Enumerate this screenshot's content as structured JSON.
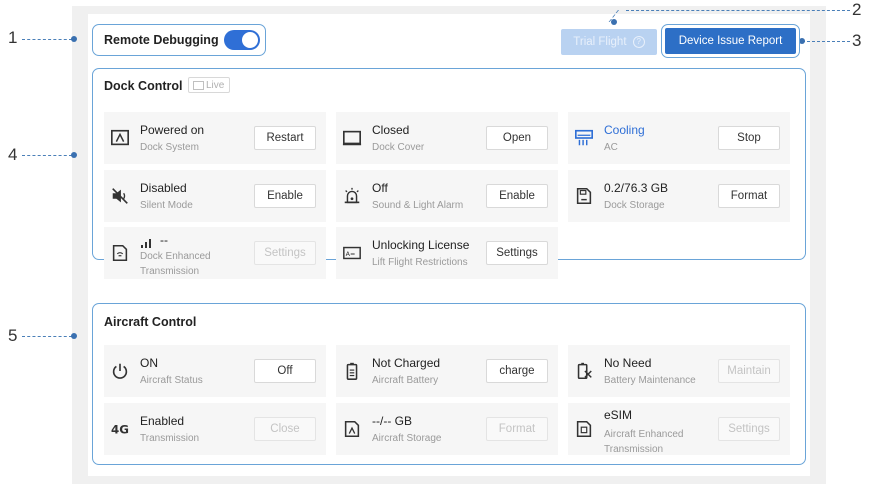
{
  "callouts": {
    "n1": "1",
    "n2": "2",
    "n3": "3",
    "n4": "4",
    "n5": "5"
  },
  "top_bar": {
    "remote_debugging_label": "Remote Debugging",
    "remote_debugging_on": true,
    "trial_flight_label": "Trial Flight",
    "device_issue_report_label": "Device Issue Report"
  },
  "dock": {
    "title": "Dock Control",
    "live_label": "Live",
    "cards": [
      {
        "title": "Powered on",
        "sub": "Dock System",
        "button": "Restart",
        "icon": "dock-system-icon"
      },
      {
        "title": "Closed",
        "sub": "Dock Cover",
        "button": "Open",
        "icon": "dock-cover-icon"
      },
      {
        "title": "Cooling",
        "sub": "AC",
        "button": "Stop",
        "icon": "ac-icon"
      },
      {
        "title": "Disabled",
        "sub": "Silent Mode",
        "button": "Enable",
        "icon": "silent-mode-icon"
      },
      {
        "title": "Off",
        "sub": "Sound & Light Alarm",
        "button": "Enable",
        "icon": "alarm-icon"
      },
      {
        "title": "0.2/76.3 GB",
        "sub": "Dock Storage",
        "button": "Format",
        "icon": "storage-icon"
      },
      {
        "title": "--",
        "sub": "Dock Enhanced Transmission",
        "button": "Settings",
        "icon": "enhanced-transmission-icon"
      },
      {
        "title": "Unlocking License",
        "sub": "Lift Flight Restrictions",
        "button": "Settings",
        "icon": "license-icon"
      }
    ]
  },
  "aircraft": {
    "title": "Aircraft Control",
    "cards": [
      {
        "title": "ON",
        "sub": "Aircraft Status",
        "button": "Off",
        "icon": "power-icon"
      },
      {
        "title": "Not Charged",
        "sub": "Aircraft Battery",
        "button": "charge",
        "icon": "battery-icon"
      },
      {
        "title": "No Need",
        "sub": "Battery Maintenance",
        "button": "Maintain",
        "icon": "battery-maintenance-icon"
      },
      {
        "title": "Enabled",
        "sub": "Transmission",
        "button": "Close",
        "icon": "4g-icon"
      },
      {
        "title": "--/-- GB",
        "sub": "Aircraft Storage",
        "button": "Format",
        "icon": "aircraft-storage-icon"
      },
      {
        "title": "eSIM",
        "sub": "Aircraft Enhanced Transmission",
        "button": "Settings",
        "icon": "esim-icon"
      }
    ]
  },
  "colors": {
    "accent": "#2f6fd6",
    "highlight": "#6aa4d8",
    "callout_line": "#4a7fb8"
  }
}
